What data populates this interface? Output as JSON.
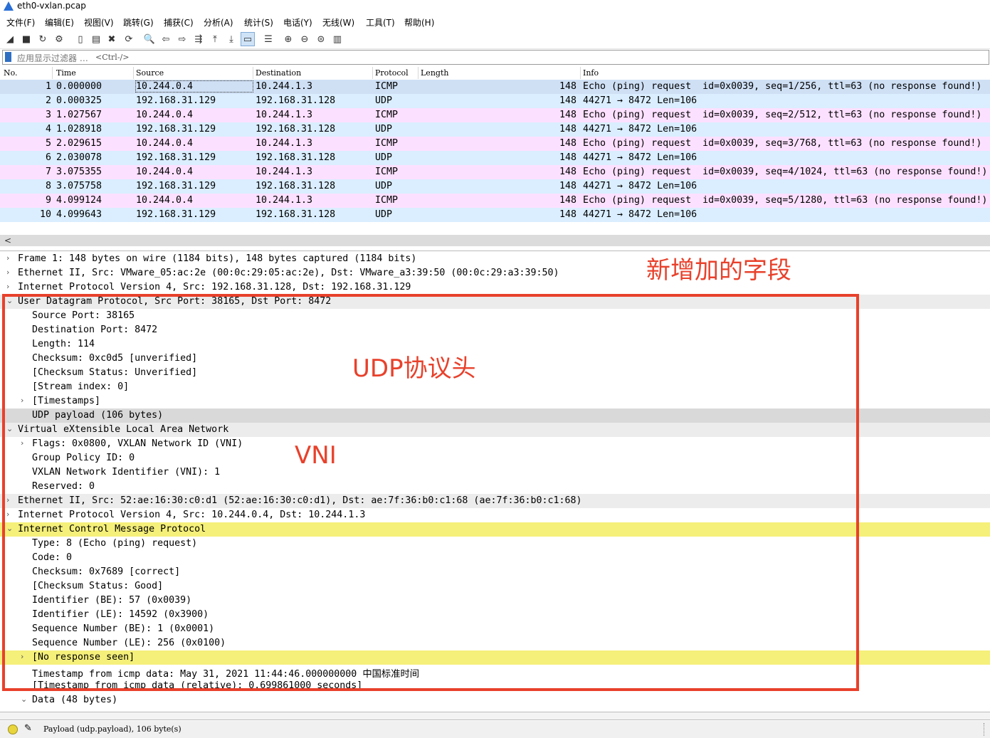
{
  "window": {
    "title": "eth0-vxlan.pcap"
  },
  "menu": [
    "文件(F)",
    "编辑(E)",
    "视图(V)",
    "跳转(G)",
    "捕获(C)",
    "分析(A)",
    "统计(S)",
    "电话(Y)",
    "无线(W)",
    "工具(T)",
    "帮助(H)"
  ],
  "toolbar": {
    "icons": [
      "start-capture-icon",
      "stop-capture-icon",
      "restart-capture-icon",
      "capture-options-icon",
      "open-file-icon",
      "save-file-icon",
      "close-file-icon",
      "reload-file-icon",
      "find-packet-icon",
      "go-back-icon",
      "go-forward-icon",
      "go-to-packet-icon",
      "first-packet-icon",
      "last-packet-icon",
      "auto-scroll-icon",
      "colorize-icon",
      "zoom-in-icon",
      "zoom-out-icon",
      "normal-size-icon",
      "resize-columns-icon"
    ],
    "glyphs": [
      "◢",
      "■",
      "↻",
      "⚙",
      "▯",
      "▤",
      "✖",
      "⟳",
      "🔍",
      "⇦",
      "⇨",
      "⇶",
      "⤒",
      "⤓",
      "▭",
      "☰",
      "⊕",
      "⊖",
      "⊜",
      "▥"
    ]
  },
  "filter": {
    "placeholder": "应用显示过滤器 …",
    "shortcut": "<Ctrl-/>"
  },
  "columns": [
    "No.",
    "Time",
    "Source",
    "Destination",
    "Protocol",
    "Length",
    "Info"
  ],
  "packets": [
    {
      "no": "1",
      "time": "0.000000",
      "src": "10.244.0.4",
      "dst": "10.244.1.3",
      "proto": "ICMP",
      "len": "148",
      "info": "Echo (ping) request  id=0x0039, seq=1/256, ttl=63 (no response found!)"
    },
    {
      "no": "2",
      "time": "0.000325",
      "src": "192.168.31.129",
      "dst": "192.168.31.128",
      "proto": "UDP",
      "len": "148",
      "info": "44271 → 8472 Len=106"
    },
    {
      "no": "3",
      "time": "1.027567",
      "src": "10.244.0.4",
      "dst": "10.244.1.3",
      "proto": "ICMP",
      "len": "148",
      "info": "Echo (ping) request  id=0x0039, seq=2/512, ttl=63 (no response found!)"
    },
    {
      "no": "4",
      "time": "1.028918",
      "src": "192.168.31.129",
      "dst": "192.168.31.128",
      "proto": "UDP",
      "len": "148",
      "info": "44271 → 8472 Len=106"
    },
    {
      "no": "5",
      "time": "2.029615",
      "src": "10.244.0.4",
      "dst": "10.244.1.3",
      "proto": "ICMP",
      "len": "148",
      "info": "Echo (ping) request  id=0x0039, seq=3/768, ttl=63 (no response found!)"
    },
    {
      "no": "6",
      "time": "2.030078",
      "src": "192.168.31.129",
      "dst": "192.168.31.128",
      "proto": "UDP",
      "len": "148",
      "info": "44271 → 8472 Len=106"
    },
    {
      "no": "7",
      "time": "3.075355",
      "src": "10.244.0.4",
      "dst": "10.244.1.3",
      "proto": "ICMP",
      "len": "148",
      "info": "Echo (ping) request  id=0x0039, seq=4/1024, ttl=63 (no response found!)"
    },
    {
      "no": "8",
      "time": "3.075758",
      "src": "192.168.31.129",
      "dst": "192.168.31.128",
      "proto": "UDP",
      "len": "148",
      "info": "44271 → 8472 Len=106"
    },
    {
      "no": "9",
      "time": "4.099124",
      "src": "10.244.0.4",
      "dst": "10.244.1.3",
      "proto": "ICMP",
      "len": "148",
      "info": "Echo (ping) request  id=0x0039, seq=5/1280, ttl=63 (no response found!)"
    },
    {
      "no": "10",
      "time": "4.099643",
      "src": "192.168.31.129",
      "dst": "192.168.31.128",
      "proto": "UDP",
      "len": "148",
      "info": "44271 → 8472 Len=106"
    }
  ],
  "details": [
    {
      "text": "Frame 1: 148 bytes on wire (1184 bits), 148 bytes captured (1184 bits)",
      "indent": 0,
      "twisty": "›",
      "style": ""
    },
    {
      "text": "Ethernet II, Src: VMware_05:ac:2e (00:0c:29:05:ac:2e), Dst: VMware_a3:39:50 (00:0c:29:a3:39:50)",
      "indent": 0,
      "twisty": "›",
      "style": ""
    },
    {
      "text": "Internet Protocol Version 4, Src: 192.168.31.128, Dst: 192.168.31.129",
      "indent": 0,
      "twisty": "›",
      "style": ""
    },
    {
      "text": "User Datagram Protocol, Src Port: 38165, Dst Port: 8472",
      "indent": 0,
      "twisty": "⌄",
      "style": "gray"
    },
    {
      "text": "Source Port: 38165",
      "indent": 1,
      "twisty": "",
      "style": ""
    },
    {
      "text": "Destination Port: 8472",
      "indent": 1,
      "twisty": "",
      "style": ""
    },
    {
      "text": "Length: 114",
      "indent": 1,
      "twisty": "",
      "style": ""
    },
    {
      "text": "Checksum: 0xc0d5 [unverified]",
      "indent": 1,
      "twisty": "",
      "style": ""
    },
    {
      "text": "[Checksum Status: Unverified]",
      "indent": 1,
      "twisty": "",
      "style": ""
    },
    {
      "text": "[Stream index: 0]",
      "indent": 1,
      "twisty": "",
      "style": ""
    },
    {
      "text": "[Timestamps]",
      "indent": 1,
      "twisty": "›",
      "style": ""
    },
    {
      "text": "UDP payload (106 bytes)",
      "indent": 1,
      "twisty": "",
      "style": "dark"
    },
    {
      "text": "Virtual eXtensible Local Area Network",
      "indent": 0,
      "twisty": "⌄",
      "style": "gray"
    },
    {
      "text": "Flags: 0x0800, VXLAN Network ID (VNI)",
      "indent": 1,
      "twisty": "›",
      "style": ""
    },
    {
      "text": "Group Policy ID: 0",
      "indent": 1,
      "twisty": "",
      "style": ""
    },
    {
      "text": "VXLAN Network Identifier (VNI): 1",
      "indent": 1,
      "twisty": "",
      "style": ""
    },
    {
      "text": "Reserved: 0",
      "indent": 1,
      "twisty": "",
      "style": ""
    },
    {
      "text": "Ethernet II, Src: 52:ae:16:30:c0:d1 (52:ae:16:30:c0:d1), Dst: ae:7f:36:b0:c1:68 (ae:7f:36:b0:c1:68)",
      "indent": 0,
      "twisty": "›",
      "style": "gray"
    },
    {
      "text": "Internet Protocol Version 4, Src: 10.244.0.4, Dst: 10.244.1.3",
      "indent": 0,
      "twisty": "›",
      "style": ""
    },
    {
      "text": "Internet Control Message Protocol",
      "indent": 0,
      "twisty": "⌄",
      "style": "yellow"
    },
    {
      "text": "Type: 8 (Echo (ping) request)",
      "indent": 1,
      "twisty": "",
      "style": ""
    },
    {
      "text": "Code: 0",
      "indent": 1,
      "twisty": "",
      "style": ""
    },
    {
      "text": "Checksum: 0x7689 [correct]",
      "indent": 1,
      "twisty": "",
      "style": ""
    },
    {
      "text": "[Checksum Status: Good]",
      "indent": 1,
      "twisty": "",
      "style": ""
    },
    {
      "text": "Identifier (BE): 57 (0x0039)",
      "indent": 1,
      "twisty": "",
      "style": ""
    },
    {
      "text": "Identifier (LE): 14592 (0x3900)",
      "indent": 1,
      "twisty": "",
      "style": ""
    },
    {
      "text": "Sequence Number (BE): 1 (0x0001)",
      "indent": 1,
      "twisty": "",
      "style": ""
    },
    {
      "text": "Sequence Number (LE): 256 (0x0100)",
      "indent": 1,
      "twisty": "",
      "style": ""
    },
    {
      "text": "[No response seen]",
      "indent": 1,
      "twisty": "›",
      "style": "yellow"
    },
    {
      "text": "Timestamp from icmp data: May 31, 2021 11:44:46.000000000 中国标准时间",
      "indent": 1,
      "twisty": "",
      "style": ""
    },
    {
      "text": "[Timestamp from icmp data (relative): 0.699861000 seconds]",
      "indent": 1,
      "twisty": "",
      "style": ""
    },
    {
      "text": "Data (48 bytes)",
      "indent": 1,
      "twisty": "⌄",
      "style": ""
    }
  ],
  "annotations": {
    "new_fields": "新增加的字段",
    "udp_header": "UDP协议头",
    "vni": "VNI",
    "color": "#e8412b"
  },
  "status": {
    "message": "Payload (udp.payload), 106 byte(s)"
  }
}
